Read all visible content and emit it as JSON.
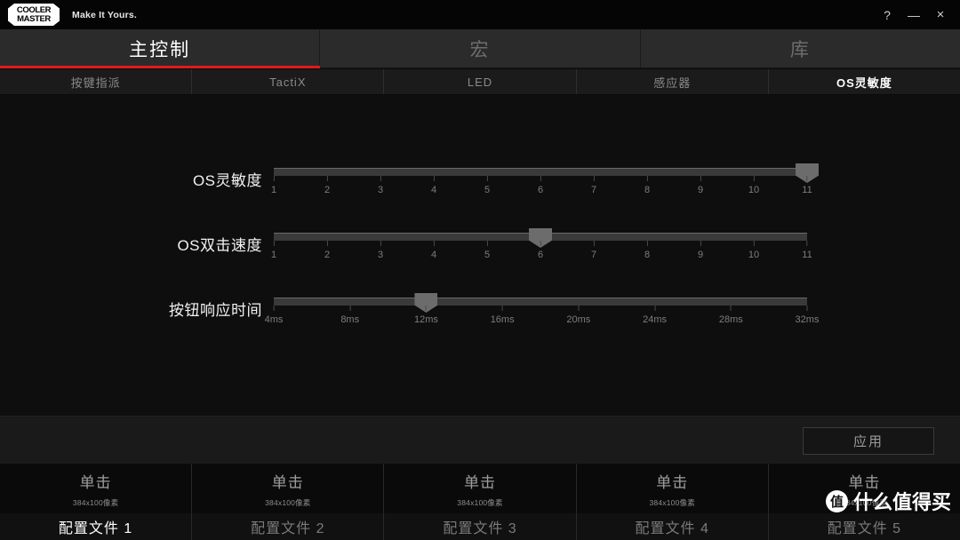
{
  "titlebar": {
    "logo_line1": "COOLER",
    "logo_line2": "MASTER",
    "tagline": "Make It Yours.",
    "help_icon": "?",
    "minimize_icon": "—",
    "close_icon": "×"
  },
  "main_tabs": [
    {
      "label": "主控制",
      "active": true
    },
    {
      "label": "宏",
      "active": false
    },
    {
      "label": "库",
      "active": false
    }
  ],
  "sub_tabs": [
    {
      "label": "按键指派",
      "active": false
    },
    {
      "label": "TactiX",
      "active": false
    },
    {
      "label": "LED",
      "active": false
    },
    {
      "label": "感应器",
      "active": false
    },
    {
      "label": "OS灵敏度",
      "active": true
    }
  ],
  "sliders": [
    {
      "label": "OS灵敏度",
      "ticks": [
        "1",
        "2",
        "3",
        "4",
        "5",
        "6",
        "7",
        "8",
        "9",
        "10",
        "11"
      ],
      "value_index": 10,
      "value": "11"
    },
    {
      "label": "OS双击速度",
      "ticks": [
        "1",
        "2",
        "3",
        "4",
        "5",
        "6",
        "7",
        "8",
        "9",
        "10",
        "11"
      ],
      "value_index": 5,
      "value": "6"
    },
    {
      "label": "按钮响应时间",
      "ticks": [
        "4ms",
        "8ms",
        "12ms",
        "16ms",
        "20ms",
        "24ms",
        "28ms",
        "32ms"
      ],
      "value_index": 2,
      "value": "12ms"
    }
  ],
  "apply_button": {
    "label": "应用"
  },
  "profiles": [
    {
      "thumb_title": "单击",
      "thumb_sub": "384x100像素",
      "name": "配置文件 1",
      "active": true
    },
    {
      "thumb_title": "单击",
      "thumb_sub": "384x100像素",
      "name": "配置文件 2",
      "active": false
    },
    {
      "thumb_title": "单击",
      "thumb_sub": "384x100像素",
      "name": "配置文件 3",
      "active": false
    },
    {
      "thumb_title": "单击",
      "thumb_sub": "384x100像素",
      "name": "配置文件 4",
      "active": false
    },
    {
      "thumb_title": "单击",
      "thumb_sub": "384x100像素",
      "name": "配置文件 5",
      "active": false
    }
  ],
  "watermark": {
    "badge": "值",
    "text": "什么值得买"
  },
  "colors": {
    "accent_red": "#e01b1b",
    "tabbar_bg": "#2b2b2b",
    "subtab_bg": "#1b1b1b",
    "content_bg": "#0e0e0e",
    "track": "#3a3a3a",
    "thumb": "#6c6c6c"
  }
}
